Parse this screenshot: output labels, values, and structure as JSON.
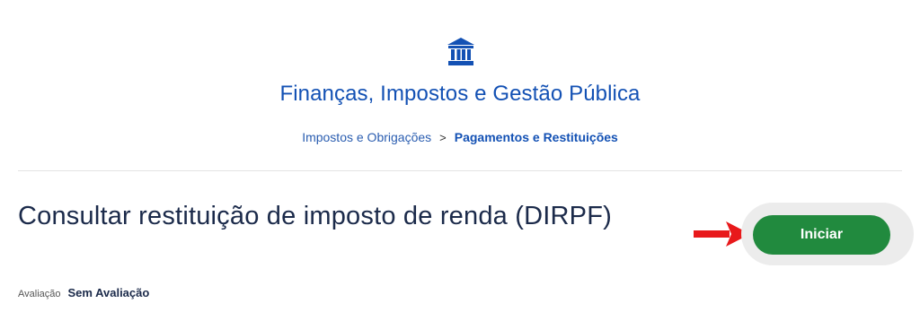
{
  "category": {
    "icon": "government-building-icon",
    "title": "Finanças, Impostos e Gestão Pública"
  },
  "breadcrumb": {
    "items": [
      "Impostos e Obrigações",
      "Pagamentos e Restituições"
    ],
    "separator": ">"
  },
  "service": {
    "title": "Consultar restituição de imposto de renda (DIRPF)",
    "start_button_label": "Iniciar"
  },
  "rating": {
    "label": "Avaliação",
    "value": "Sem Avaliação"
  },
  "annotation": {
    "icon": "red-arrow-icon"
  },
  "colors": {
    "accent_blue": "#1351b4",
    "title_navy": "#1b2a4a",
    "button_green": "#218a3e",
    "annotation_red": "#e8191b"
  }
}
